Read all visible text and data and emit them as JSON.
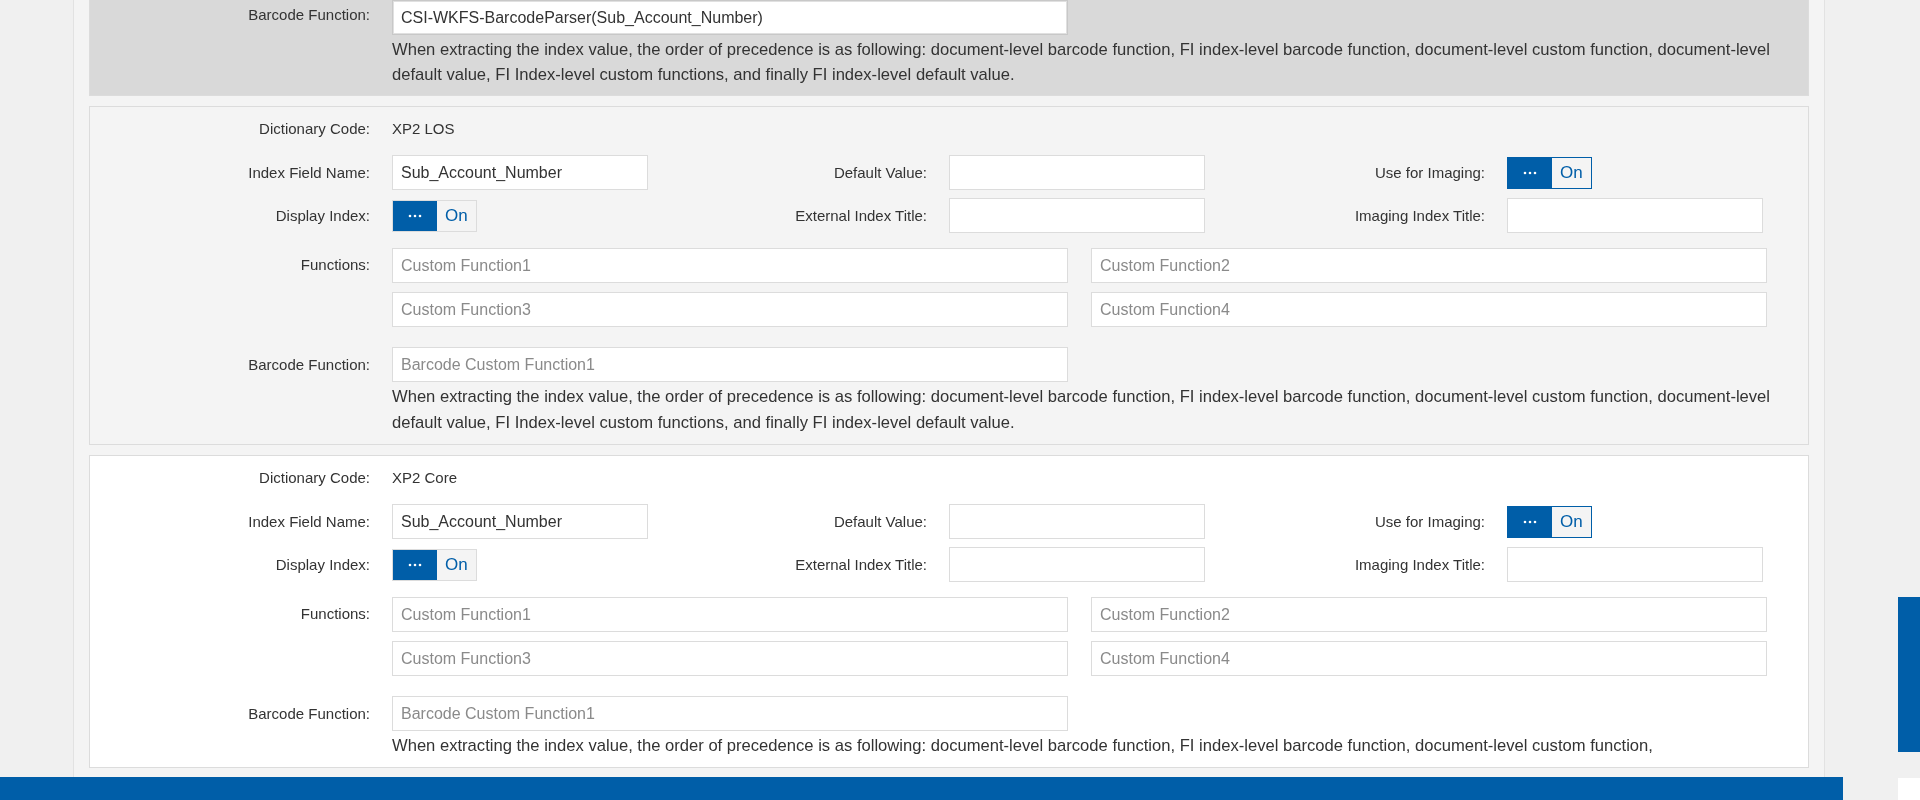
{
  "sections": [
    {
      "kind": "active",
      "barcode": {
        "label": "Barcode Function:",
        "value": "CSI-WKFS-BarcodeParser(Sub_Account_Number)",
        "focused": true
      },
      "note": "When extracting the index value, the order of precedence is as following: document-level barcode function, FI index-level barcode function, document-level custom function, document-level default value, FI Index-level custom functions, and finally FI index-level default value."
    },
    {
      "kind": "hover",
      "dictionary": {
        "label": "Dictionary Code:",
        "value": "XP2 LOS"
      },
      "index_field_name": {
        "label": "Index Field Name:",
        "value": "Sub_Account_Number"
      },
      "default_value": {
        "label": "Default Value:"
      },
      "use_for_imaging": {
        "label": "Use for Imaging:",
        "text": "On",
        "on": true,
        "focused": true
      },
      "display_index": {
        "label": "Display Index:",
        "text": "On",
        "on": true,
        "focused": false
      },
      "external_index_title": {
        "label": "External Index Title:"
      },
      "imaging_index_title": {
        "label": "Imaging Index Title:"
      },
      "functions": {
        "label": "Functions:",
        "fields": [
          {
            "placeholder": "Custom Function1"
          },
          {
            "placeholder": "Custom Function2"
          },
          {
            "placeholder": "Custom Function3"
          },
          {
            "placeholder": "Custom Function4"
          }
        ]
      },
      "barcode": {
        "label": "Barcode Function:",
        "placeholder": "Barcode Custom Function1"
      },
      "note": "When extracting the index value, the order of precedence is as following: document-level barcode function, FI index-level barcode function, document-level custom function, document-level default value, FI Index-level custom functions, and finally FI index-level default value."
    },
    {
      "kind": "plain",
      "dictionary": {
        "label": "Dictionary Code:",
        "value": "XP2 Core"
      },
      "index_field_name": {
        "label": "Index Field Name:",
        "value": "Sub_Account_Number"
      },
      "default_value": {
        "label": "Default Value:"
      },
      "use_for_imaging": {
        "label": "Use for Imaging:",
        "text": "On",
        "on": true,
        "focused": true
      },
      "display_index": {
        "label": "Display Index:",
        "text": "On",
        "on": true,
        "focused": false
      },
      "external_index_title": {
        "label": "External Index Title:"
      },
      "imaging_index_title": {
        "label": "Imaging Index Title:"
      },
      "functions": {
        "label": "Functions:",
        "fields": [
          {
            "placeholder": "Custom Function1"
          },
          {
            "placeholder": "Custom Function2"
          },
          {
            "placeholder": "Custom Function3"
          },
          {
            "placeholder": "Custom Function4"
          }
        ]
      },
      "barcode": {
        "label": "Barcode Function:",
        "placeholder": "Barcode Custom Function1"
      },
      "note": "When extracting the index value, the order of precedence is as following: document-level barcode function, FI index-level barcode function, document-level custom function,"
    }
  ]
}
